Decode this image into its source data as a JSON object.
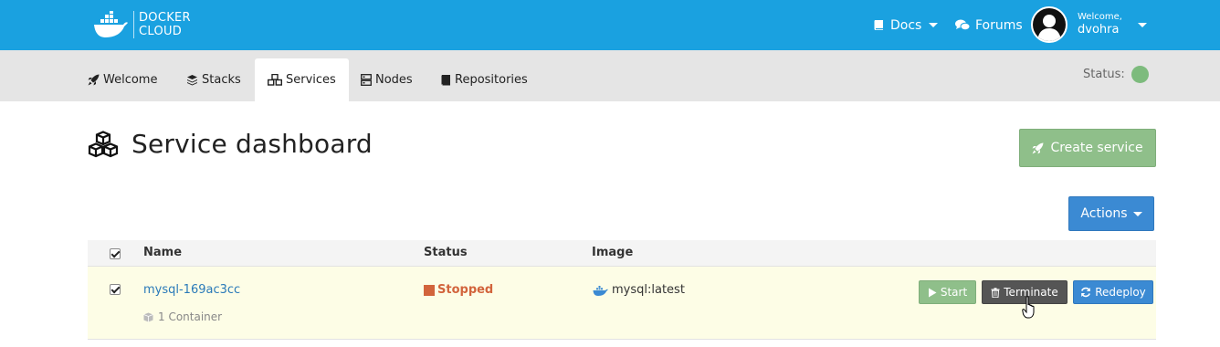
{
  "header": {
    "logo_line1": "DOCKER",
    "logo_line2": "CLOUD",
    "docs_label": "Docs",
    "forums_label": "Forums",
    "welcome_label": "Welcome,",
    "username": "dvohra"
  },
  "tabs": [
    {
      "label": "Welcome",
      "icon": "rocket-icon"
    },
    {
      "label": "Stacks",
      "icon": "stack-icon"
    },
    {
      "label": "Services",
      "icon": "cubes-icon",
      "active": true
    },
    {
      "label": "Nodes",
      "icon": "server-icon"
    },
    {
      "label": "Repositories",
      "icon": "book-icon"
    }
  ],
  "status": {
    "label": "Status:",
    "color": "#7dbb7d"
  },
  "page": {
    "title": "Service dashboard",
    "create_label": "Create service",
    "actions_label": "Actions"
  },
  "table": {
    "columns": [
      "Name",
      "Status",
      "Image"
    ],
    "rows": [
      {
        "name": "mysql-169ac3cc",
        "containers": "1 Container",
        "status": "Stopped",
        "image": "mysql:latest",
        "checked": true,
        "buttons": {
          "start": "Start",
          "terminate": "Terminate",
          "redeploy": "Redeploy"
        }
      }
    ]
  },
  "colors": {
    "topbar": "#1aa1e0",
    "success": "#8fbf8a",
    "primary": "#3b8ad3",
    "stopped": "#d2643c",
    "row_highlight": "#fdfde6"
  }
}
